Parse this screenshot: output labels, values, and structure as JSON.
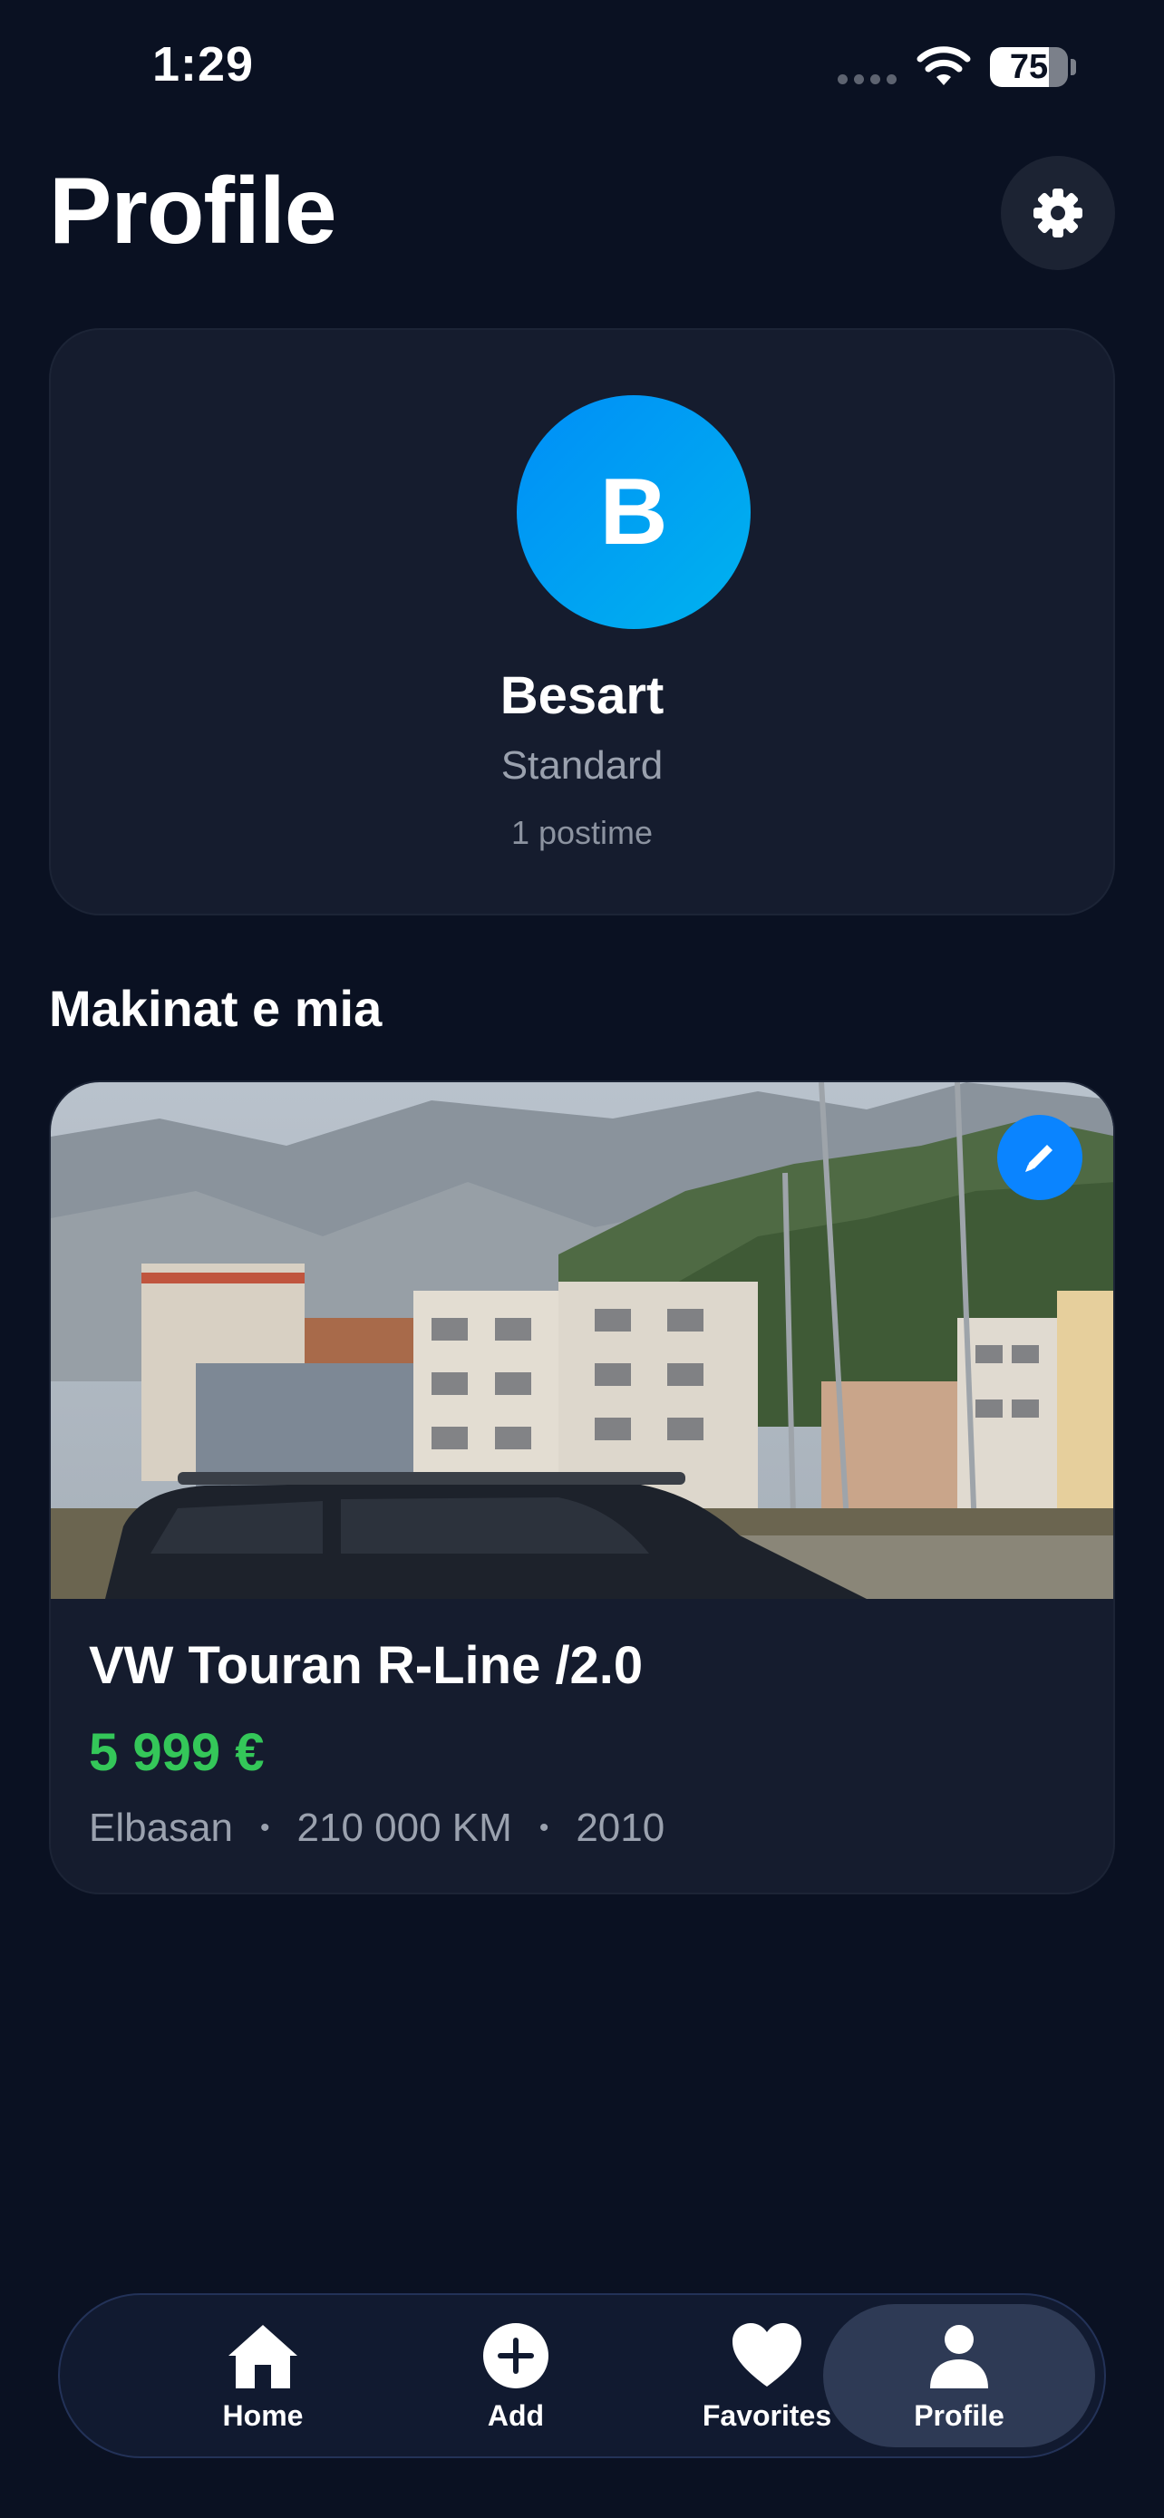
{
  "status_bar": {
    "time": "1:29",
    "battery_percent": 75,
    "battery_label": "75"
  },
  "header": {
    "title": "Profile",
    "settings_icon": "gear-icon"
  },
  "profile": {
    "avatar_initial": "B",
    "name": "Besart",
    "tier": "Standard",
    "posts": "1 postime"
  },
  "section": {
    "title": "Makinat e mia"
  },
  "listing": {
    "title": "VW Touran R-Line /2.0",
    "price": "5 999 €",
    "location": "Elbasan",
    "mileage": "210 000 KM",
    "year": "2010",
    "separator": "•",
    "edit_icon": "pencil-icon"
  },
  "tabs": [
    {
      "label": "Home",
      "icon": "house-icon",
      "active": false
    },
    {
      "label": "Add",
      "icon": "plus-circle-icon",
      "active": false
    },
    {
      "label": "Favorites",
      "icon": "heart-icon",
      "active": false
    },
    {
      "label": "Profile",
      "icon": "person-icon",
      "active": true
    }
  ],
  "colors": {
    "background": "#0a1122",
    "card": "#151c2e",
    "accent": "#0a84ff",
    "price": "#34c759"
  }
}
